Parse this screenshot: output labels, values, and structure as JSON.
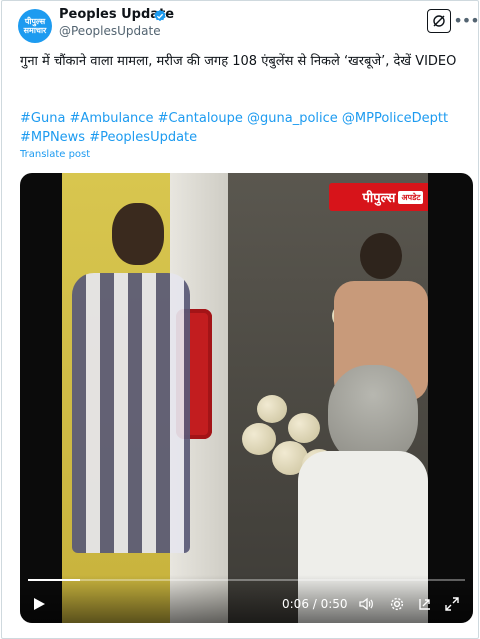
{
  "account": {
    "avatar_line1": "पीपुल्स",
    "avatar_line2": "समाचार",
    "name": "Peoples Update",
    "handle": "@PeoplesUpdate"
  },
  "post": {
    "text": "गुना में चौंकाने वाला मामला, मरीज की जगह 108 एंबुलेंस से निकले ‘खरबूजे’, देखें VIDEO",
    "hashtags": "#Guna #Ambulance #Cantaloupe @guna_police @MPPoliceDeptt #MPNews #PeoplesUpdate",
    "translate_label": "Translate post"
  },
  "video": {
    "logo_text": "पीपुल्स",
    "logo_sub": "अपडेट",
    "time": "0:06 / 0:50",
    "progress_fraction": 0.12
  },
  "colors": {
    "accent": "#1d9bf0",
    "text": "#0f1419",
    "muted": "#536471",
    "logo_red": "#d7141a"
  },
  "icons": {
    "verified": "verified-badge-icon",
    "grok": "grok-icon",
    "more": "more-icon",
    "play": "play-icon",
    "volume": "volume-icon",
    "settings": "settings-icon",
    "pip": "picture-in-picture-icon",
    "fullscreen": "fullscreen-icon"
  }
}
